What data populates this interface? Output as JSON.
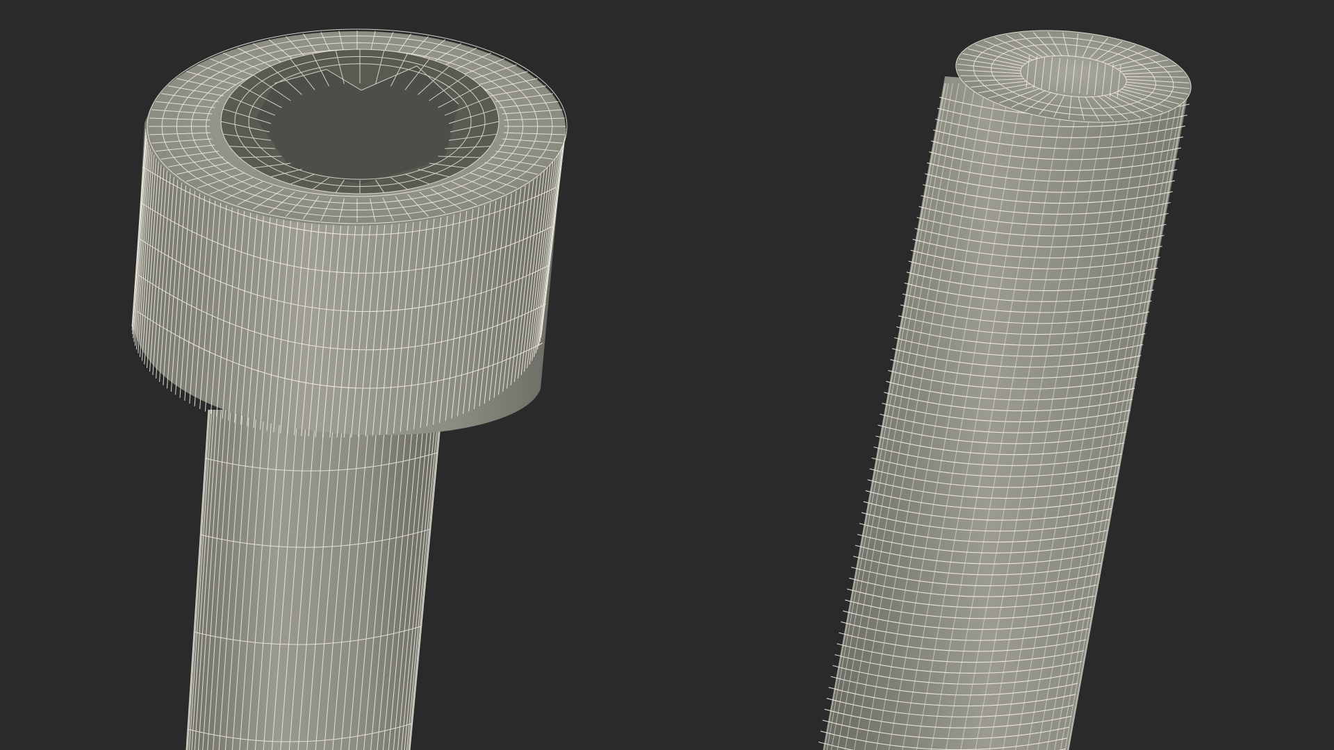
{
  "scene": {
    "subject": "socket-head-cap-screw-wireframe-render",
    "objects": [
      "screw-head-closeup",
      "threaded-shank-closeup"
    ],
    "colors": {
      "background": "#2a2a2a",
      "surface": "#8a8a80",
      "surface_shadow": "#5f5f57",
      "socket_interior": "#4e4e48",
      "wire": "#f4f1e6"
    },
    "wireframe": true
  }
}
